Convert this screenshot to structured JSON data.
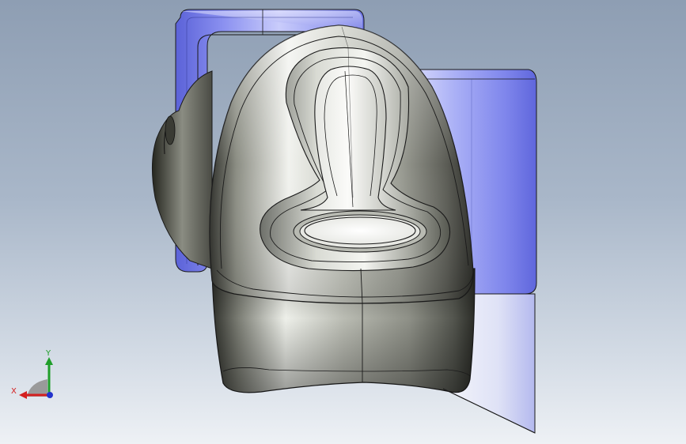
{
  "viewport": {
    "background_top": "#8e9eb3",
    "background_bottom": "#eef1f5",
    "model": {
      "name": "barcode-scanner-on-stand",
      "body_color": "#c9cbc3",
      "stand_color": "#7f85e8",
      "edge_color": "#1a1a1a"
    }
  },
  "triad": {
    "x_label": "X",
    "y_label": "Y",
    "x_color": "#d42020",
    "y_color": "#1f9e2a",
    "z_color": "#2233cc"
  }
}
